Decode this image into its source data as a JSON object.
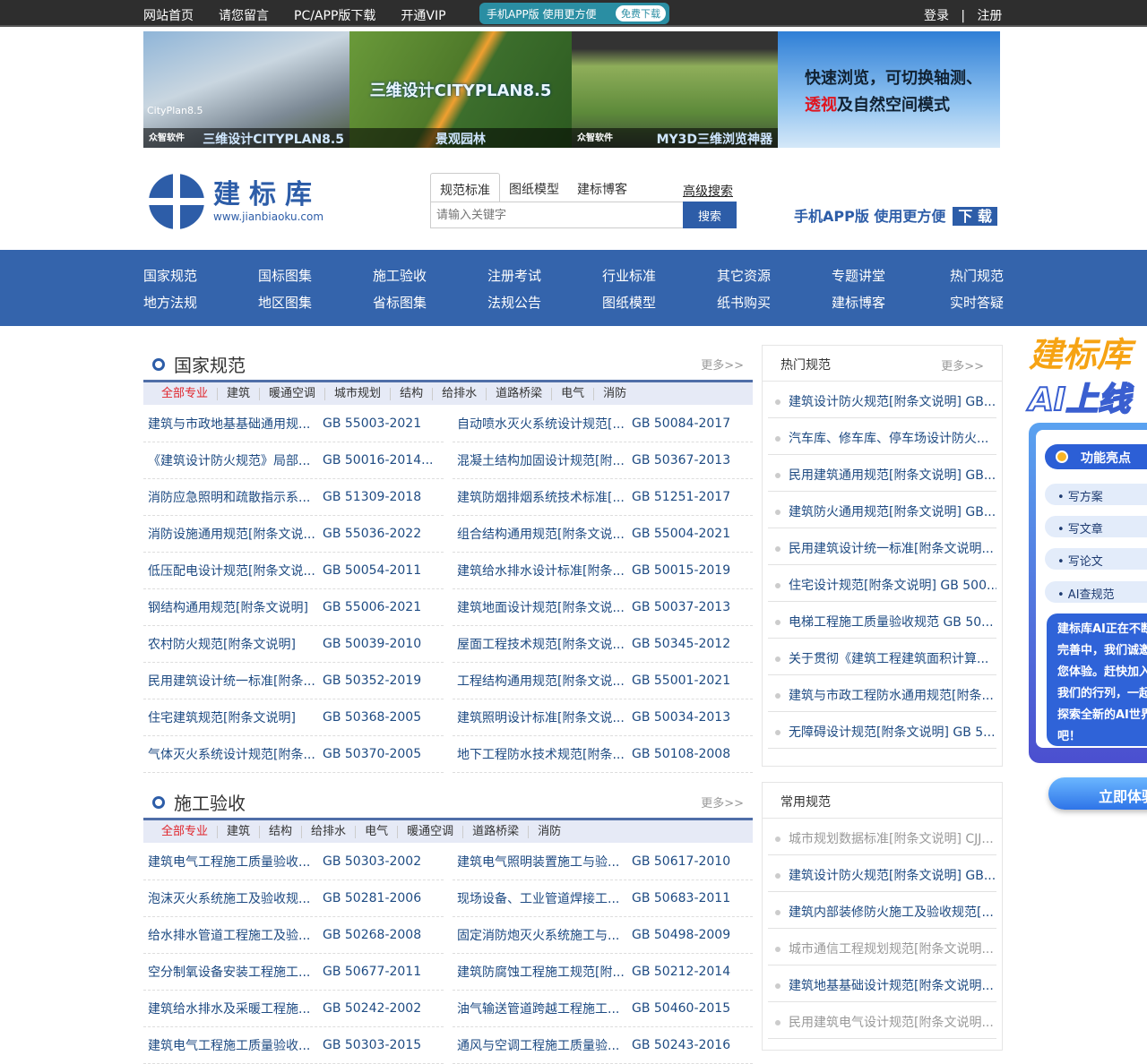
{
  "topbar": {
    "links": [
      "网站首页",
      "请您留言",
      "PC/APP版下载",
      "开通VIP"
    ],
    "app_promo": "手机APP版 使用更方便",
    "app_promo_btn": "免费下载",
    "login": "登录",
    "sep": "|",
    "register": "注册"
  },
  "banners": [
    {
      "corner": "CityPlan8.5",
      "brand": "众智软件",
      "caption": "三维设计CITYPLAN8.5"
    },
    {
      "title": "三维设计CITYPLAN8.5",
      "caption": "景观园林"
    },
    {
      "brand": "众智软件",
      "caption": "MY3D三维浏览神器"
    },
    {
      "line1": "快速浏览，可切换轴测、",
      "highlight": "透视",
      "line2": "及自然空间模式"
    }
  ],
  "logo": {
    "name": "建标库",
    "url": "www.jianbiaoku.com"
  },
  "search": {
    "tabs": [
      "规范标准",
      "图纸模型",
      "建标博客"
    ],
    "advanced": "高级搜索",
    "placeholder": "请输入关键字",
    "button": "搜索"
  },
  "app_download": {
    "text": "手机APP版  使用更方便",
    "button": "下 载"
  },
  "nav": [
    [
      "国家规范",
      "国标图集",
      "施工验收",
      "注册考试",
      "行业标准",
      "其它资源",
      "专题讲堂",
      "热门规范"
    ],
    [
      "地方法规",
      "地区图集",
      "省标图集",
      "法规公告",
      "图纸模型",
      "纸书购买",
      "建标博客",
      "实时答疑"
    ]
  ],
  "sections": [
    {
      "title": "国家规范",
      "more": "更多>>",
      "cats": [
        "全部专业",
        "建筑",
        "暖通空调",
        "城市规划",
        "结构",
        "给排水",
        "道路桥梁",
        "电气",
        "消防"
      ],
      "rows": [
        [
          [
            "建筑与市政地基基础通用规...",
            "GB 55003-2021"
          ],
          [
            "自动喷水灭火系统设计规范[...",
            "GB 50084-2017"
          ]
        ],
        [
          [
            "《建筑设计防火规范》局部...",
            "GB 50016-2014..."
          ],
          [
            "混凝土结构加固设计规范[附...",
            "GB 50367-2013"
          ]
        ],
        [
          [
            "消防应急照明和疏散指示系...",
            "GB 51309-2018"
          ],
          [
            "建筑防烟排烟系统技术标准[...",
            "GB 51251-2017"
          ]
        ],
        [
          [
            "消防设施通用规范[附条文说...",
            "GB 55036-2022"
          ],
          [
            "组合结构通用规范[附条文说...",
            "GB 55004-2021"
          ]
        ],
        [
          [
            "低压配电设计规范[附条文说...",
            "GB 50054-2011"
          ],
          [
            "建筑给水排水设计标准[附条...",
            "GB 50015-2019"
          ]
        ],
        [
          [
            "钢结构通用规范[附条文说明]",
            "GB 55006-2021"
          ],
          [
            "建筑地面设计规范[附条文说...",
            "GB 50037-2013"
          ]
        ],
        [
          [
            "农村防火规范[附条文说明]",
            "GB 50039-2010"
          ],
          [
            "屋面工程技术规范[附条文说...",
            "GB 50345-2012"
          ]
        ],
        [
          [
            "民用建筑设计统一标准[附条...",
            "GB 50352-2019"
          ],
          [
            "工程结构通用规范[附条文说...",
            "GB 55001-2021"
          ]
        ],
        [
          [
            "住宅建筑规范[附条文说明]",
            "GB 50368-2005"
          ],
          [
            "建筑照明设计标准[附条文说...",
            "GB 50034-2013"
          ]
        ],
        [
          [
            "气体灭火系统设计规范[附条...",
            "GB 50370-2005"
          ],
          [
            "地下工程防水技术规范[附条...",
            "GB 50108-2008"
          ]
        ]
      ]
    },
    {
      "title": "施工验收",
      "more": "更多>>",
      "cats": [
        "全部专业",
        "建筑",
        "结构",
        "给排水",
        "电气",
        "暖通空调",
        "道路桥梁",
        "消防"
      ],
      "rows": [
        [
          [
            "建筑电气工程施工质量验收...",
            "GB 50303-2002"
          ],
          [
            "建筑电气照明装置施工与验...",
            "GB 50617-2010"
          ]
        ],
        [
          [
            "泡沫灭火系统施工及验收规...",
            "GB 50281-2006"
          ],
          [
            "现场设备、工业管道焊接工...",
            "GB 50683-2011"
          ]
        ],
        [
          [
            "给水排水管道工程施工及验...",
            "GB 50268-2008"
          ],
          [
            "固定消防炮灭火系统施工与...",
            "GB 50498-2009"
          ]
        ],
        [
          [
            "空分制氧设备安装工程施工...",
            "GB 50677-2011"
          ],
          [
            "建筑防腐蚀工程施工规范[附...",
            "GB 50212-2014"
          ]
        ],
        [
          [
            "建筑给水排水及采暖工程施...",
            "GB 50242-2002"
          ],
          [
            "油气输送管道跨越工程施工...",
            "GB 50460-2015"
          ]
        ],
        [
          [
            "建筑电气工程施工质量验收...",
            "GB 50303-2015"
          ],
          [
            "通风与空调工程施工质量验...",
            "GB 50243-2016"
          ]
        ]
      ]
    }
  ],
  "hot": {
    "title": "热门规范",
    "more": "更多>>",
    "items": [
      "建筑设计防火规范[附条文说明] GB...",
      "汽车库、修车库、停车场设计防火...",
      "民用建筑通用规范[附条文说明] GB...",
      "建筑防火通用规范[附条文说明] GB...",
      "民用建筑设计统一标准[附条文说明...",
      "住宅设计规范[附条文说明] GB 500...",
      "电梯工程施工质量验收规范 GB 50...",
      "关于贯彻《建筑工程建筑面积计算...",
      "建筑与市政工程防水通用规范[附条...",
      "无障碍设计规范[附条文说明] GB 5..."
    ]
  },
  "common": {
    "title": "常用规范",
    "items": [
      {
        "t": "城市规划数据标准[附条文说明] CJJ...",
        "g": true
      },
      {
        "t": "建筑设计防火规范[附条文说明] GB...",
        "g": false
      },
      {
        "t": "建筑内部装修防火施工及验收规范[...",
        "g": false
      },
      {
        "t": "城市通信工程规划规范[附条文说明...",
        "g": true
      },
      {
        "t": "建筑地基基础设计规范[附条文说明...",
        "g": false
      },
      {
        "t": "民用建筑电气设计规范[附条文说明...",
        "g": true
      }
    ]
  },
  "ai": {
    "title1": "建标库",
    "title2": "AI上线",
    "feature_title": "功能亮点",
    "features": [
      "• 写方案",
      "• 写文章",
      "• 写论文",
      "• AI查规范"
    ],
    "message": "建标库AI正在不断完善中，我们诚邀您体验。赶快加入我们的行列，一起探索全新的AI世界吧！",
    "button": "立即体验"
  }
}
